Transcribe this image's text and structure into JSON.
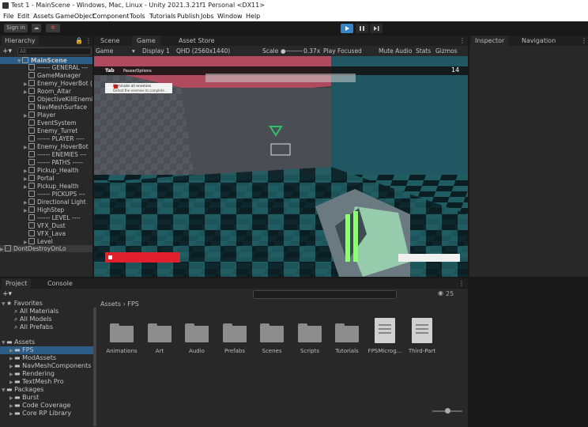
{
  "window": {
    "title": "Test 1 - MainScene - Windows, Mac, Linux - Unity 2021.3.21f1 Personal <DX11>"
  },
  "menu": [
    "File",
    "Edit",
    "Assets",
    "GameObject",
    "Component",
    "Tools",
    "Tutorials",
    "Publish",
    "Jobs",
    "Window",
    "Help"
  ],
  "toolbar": {
    "signin": "Sign in"
  },
  "hierarchy": {
    "tab": "Hierarchy",
    "search_placeholder": "All",
    "scene": "MainScene",
    "items": [
      "------ GENERAL ---",
      "GameManager",
      "Enemy_HoverBot (",
      "Room_Altar",
      "ObjectiveKillEnemi",
      "NavMeshSurface",
      "Player",
      "EventSystem",
      "Enemy_Turret",
      "------ PLAYER ----",
      "Enemy_HoverBot",
      "------ ENEMIES ---",
      "------ PATHS -----",
      "Pickup_Health",
      "Portal",
      "Pickup_Health",
      "------ PICKUPS ---",
      "Directional Light",
      "HighStep",
      "------ LEVEL ----",
      "VFX_Dust",
      "VFX_Lava",
      "Level"
    ],
    "dontdestroy": "DontDestroyOnLo"
  },
  "scene_tabs": [
    "Scene",
    "Game",
    "Asset Store"
  ],
  "game_controls": {
    "display_mode": "Game",
    "display": "Display 1",
    "resolution": "QHD (2560x1440)",
    "scale_label": "Scale",
    "scale_value": "0.37x",
    "play_focused": "Play Focused",
    "mute": "Mute Audio",
    "stats": "Stats",
    "gizmos": "Gizmos"
  },
  "hud": {
    "tab_label": "Tab",
    "pause_label": "Pause/Options",
    "objective_title": "Eliminate all enemies",
    "objective_sub": "Defeat the enemies to complete...",
    "enemy_count": "14"
  },
  "right_tabs": [
    "Inspector",
    "Navigation"
  ],
  "project": {
    "tabs": [
      "Project",
      "Console"
    ],
    "favorites": "Favorites",
    "fav_items": [
      "All Materials",
      "All Models",
      "All Prefabs"
    ],
    "assets": "Assets",
    "asset_items": [
      "FPS",
      "ModAssets",
      "NavMeshComponents",
      "Rendering",
      "TextMesh Pro"
    ],
    "packages": "Packages",
    "package_items": [
      "Burst",
      "Code Coverage",
      "Core RP Library"
    ],
    "breadcrumb_root": "Assets",
    "breadcrumb_sep": "›",
    "breadcrumb_leaf": "FPS",
    "hidden_count": "25",
    "files": [
      "Animations",
      "Art",
      "Audio",
      "Prefabs",
      "Scenes",
      "Scripts",
      "Tutorials",
      "FPSMicrog...",
      "Third-Part"
    ]
  },
  "colors": {
    "accent": "#3b82c4",
    "health": "#e0202c",
    "panel": "#282828"
  }
}
